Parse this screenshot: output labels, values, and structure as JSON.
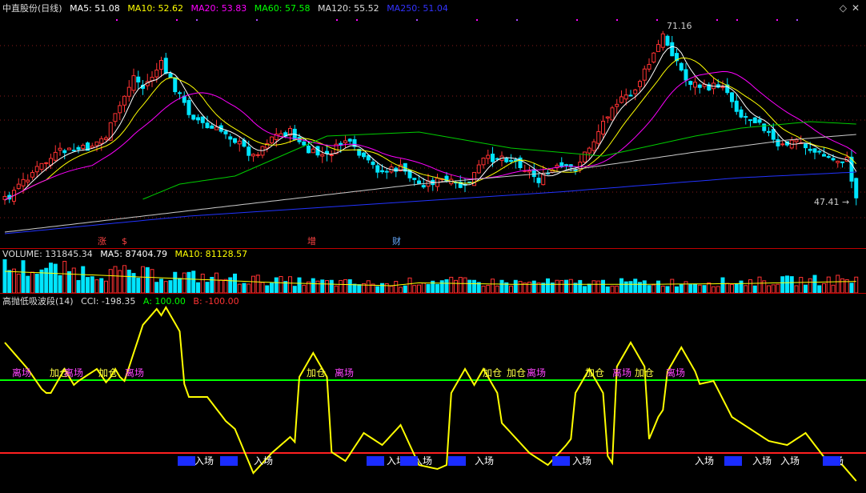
{
  "price": {
    "title": "中直股份(日线)",
    "ma": [
      {
        "label": "MA5: 51.08",
        "color": "#ffffff"
      },
      {
        "label": "MA10: 52.62",
        "color": "#ffff00"
      },
      {
        "label": "MA20: 53.83",
        "color": "#ff00ff"
      },
      {
        "label": "MA60: 57.58",
        "color": "#00ff00"
      },
      {
        "label": "MA120: 55.52",
        "color": "#dddddd"
      },
      {
        "label": "MA250: 51.04",
        "color": "#3333ff"
      }
    ],
    "high_label": "71.16",
    "low_label": "47.41",
    "events": [
      {
        "text": "涨",
        "color": "#ff4444"
      },
      {
        "text": "$",
        "color": "#ff4444"
      },
      {
        "text": "增",
        "color": "#ff4444"
      },
      {
        "text": "财",
        "color": "#66aaff"
      }
    ]
  },
  "volume": {
    "items": [
      {
        "label": "VOLUME: 131845.34",
        "color": "#dddddd"
      },
      {
        "label": "MA5: 87404.79",
        "color": "#ffffff"
      },
      {
        "label": "MA10: 81128.57",
        "color": "#ffff00"
      }
    ]
  },
  "cci": {
    "items": [
      {
        "label": "高抛低吸波段(14)",
        "color": "#dddddd"
      },
      {
        "label": "CCI: -198.35",
        "color": "#dddddd"
      },
      {
        "label": "A: 100.00",
        "color": "#00ff00"
      },
      {
        "label": "B: -100.00",
        "color": "#ff3333"
      }
    ],
    "upper_level": 100,
    "lower_level": -100,
    "signals_top": [
      "离场",
      "加仓",
      "离场",
      "加仓",
      "离场",
      "加仓",
      "离场",
      "加仓",
      "加仓",
      "离场",
      "加仓",
      "离场",
      "加仓",
      "离场"
    ],
    "signals_bottom": [
      "入场",
      "入场",
      "入场",
      "入场",
      "入场",
      "入场",
      "入场",
      "入场",
      "入场",
      "入场"
    ]
  },
  "icons": [
    "settings-icon",
    "close-icon"
  ]
}
